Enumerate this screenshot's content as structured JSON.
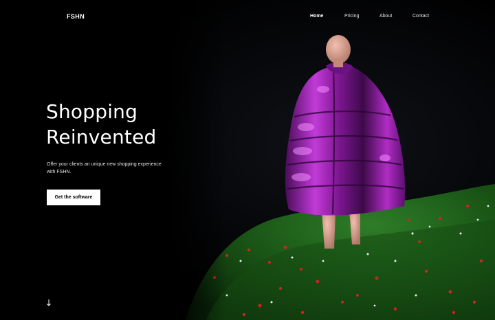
{
  "header": {
    "logo": "FSHN",
    "nav": [
      {
        "label": "Home",
        "active": true
      },
      {
        "label": "Pricing",
        "active": false
      },
      {
        "label": "About",
        "active": false
      },
      {
        "label": "Contact",
        "active": false
      }
    ]
  },
  "hero": {
    "title_line1": "Shopping",
    "title_line2": "Reinvented",
    "subtitle": "Offer your clients an unique new shopping experience with FSHN.",
    "cta_label": "Get the software",
    "scroll_icon": "arrow-down-icon"
  },
  "colors": {
    "background": "#000000",
    "text": "#ffffff",
    "button_bg": "#ffffff",
    "button_text": "#000000",
    "jacket": "#a020b0",
    "grass": "#1d6a1a",
    "flowers": "#d22020"
  }
}
